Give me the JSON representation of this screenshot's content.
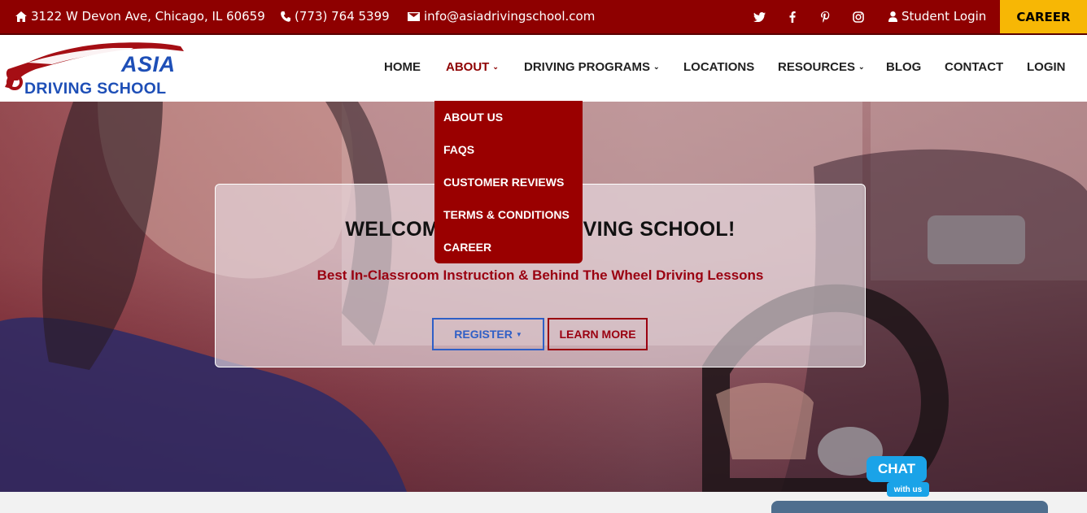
{
  "topbar": {
    "address": "3122 W Devon Ave, Chicago, IL 60659",
    "phone": "(773) 764 5399",
    "email": "info@asiadrivingschool.com",
    "student_login": "Student Login",
    "career": "CAREER"
  },
  "logo": {
    "line1": "ASIA",
    "line2": "DRIVING SCHOOL"
  },
  "nav": {
    "home": "HOME",
    "about": "ABOUT",
    "driving_programs": "DRIVING PROGRAMS",
    "locations": "LOCATIONS",
    "resources": "RESOURCES",
    "blog": "BLOG",
    "contact": "CONTACT",
    "login": "LOGIN"
  },
  "about_menu": [
    "ABOUT US",
    "FAQS",
    "CUSTOMER REVIEWS",
    "TERMS & CONDITIONS",
    "CAREER"
  ],
  "hero": {
    "title": "WELCOME TO ASIA DRIVING SCHOOL!",
    "subtitle": "Best In-Classroom Instruction & Behind The Wheel Driving Lessons",
    "register": "REGISTER",
    "learn_more": "LEARN MORE"
  },
  "chat": {
    "label": "CHAT",
    "sub": "with us"
  },
  "colors": {
    "brand_red": "#8e0000",
    "accent_yellow": "#f7b705",
    "logo_blue": "#1e4fb7"
  }
}
